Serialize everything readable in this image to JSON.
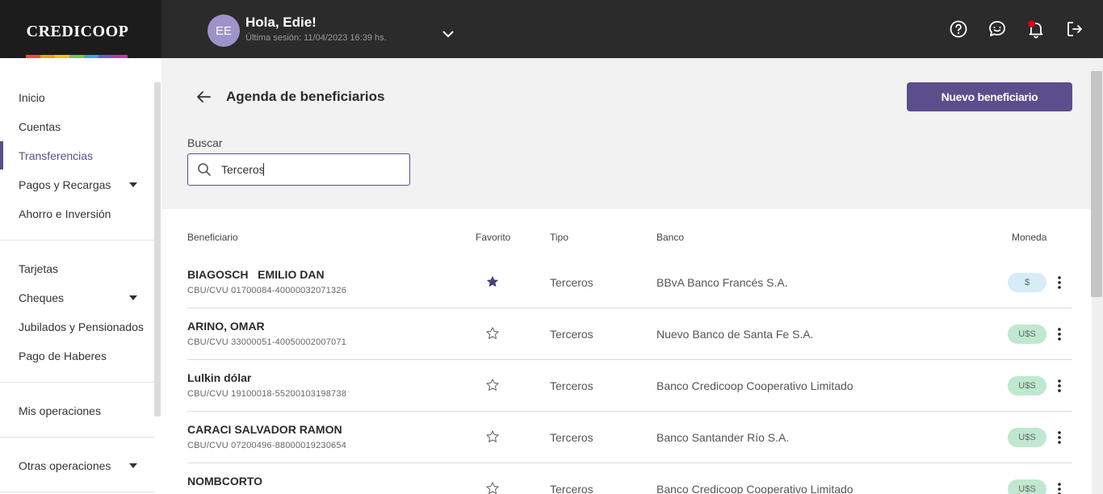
{
  "brand": {
    "name": "CREDICOOP",
    "stripe_colors": [
      "#e94e3c",
      "#f39c12",
      "#f1c40f",
      "#7cc242",
      "#3aa6d9",
      "#6a5acd",
      "#c0399b"
    ]
  },
  "header": {
    "avatar_initials": "EE",
    "greeting": "Hola, Edie!",
    "last_session": "Última sesión: 11/04/2023 16:39 hs.",
    "icons": [
      "help-icon",
      "chat-icon",
      "bell-icon",
      "logout-icon"
    ]
  },
  "sidebar": {
    "items": [
      {
        "label": "Inicio"
      },
      {
        "label": "Cuentas"
      },
      {
        "label": "Transferencias",
        "active": true
      },
      {
        "label": "Pagos y Recargas",
        "expandable": true
      },
      {
        "label": "Ahorro e Inversión"
      },
      {
        "label": "Tarjetas"
      },
      {
        "label": "Cheques",
        "expandable": true
      },
      {
        "label": "Jubilados y Pensionados"
      },
      {
        "label": "Pago de Haberes"
      },
      {
        "label": "Mis operaciones"
      },
      {
        "label": "Otras operaciones",
        "expandable": true
      }
    ]
  },
  "page": {
    "title": "Agenda de beneficiarios",
    "new_button": "Nuevo beneficiario",
    "search_label": "Buscar",
    "search_value": "Terceros"
  },
  "table": {
    "headers": {
      "beneficiary": "Beneficiario",
      "favorite": "Favorito",
      "type": "Tipo",
      "bank": "Banco",
      "currency": "Moneda"
    },
    "rows": [
      {
        "name": "BIAGOSCH   EMILIO DAN",
        "cbu": "CBU/CVU 01700084-40000032071326",
        "favorite": true,
        "type": "Terceros",
        "bank": "BBvA Banco Francés S.A.",
        "currency": "$"
      },
      {
        "name": "ARINO, OMAR",
        "cbu": "CBU/CVU 33000051-40050002007071",
        "favorite": false,
        "type": "Terceros",
        "bank": "Nuevo Banco de Santa Fe S.A.",
        "currency": "U$S"
      },
      {
        "name": "Lulkin dólar",
        "cbu": "CBU/CVU 19100018-55200103198738",
        "favorite": false,
        "type": "Terceros",
        "bank": "Banco Credicoop Cooperativo Limitado",
        "currency": "U$S"
      },
      {
        "name": "CARACI SALVADOR RAMON",
        "cbu": "CBU/CVU 07200496-88000019230654",
        "favorite": false,
        "type": "Terceros",
        "bank": "Banco Santander Río S.A.",
        "currency": "U$S"
      },
      {
        "name": "NOMBCORTO",
        "cbu": "",
        "favorite": false,
        "type": "Terceros",
        "bank": "Banco Credicoop Cooperativo Limitado",
        "currency": "U$S"
      }
    ]
  },
  "colors": {
    "accent": "#5b4e8c",
    "topbar": "#2b2b2b",
    "peso_badge": "#d6ecf7",
    "dollar_badge": "#bfe8cf"
  }
}
